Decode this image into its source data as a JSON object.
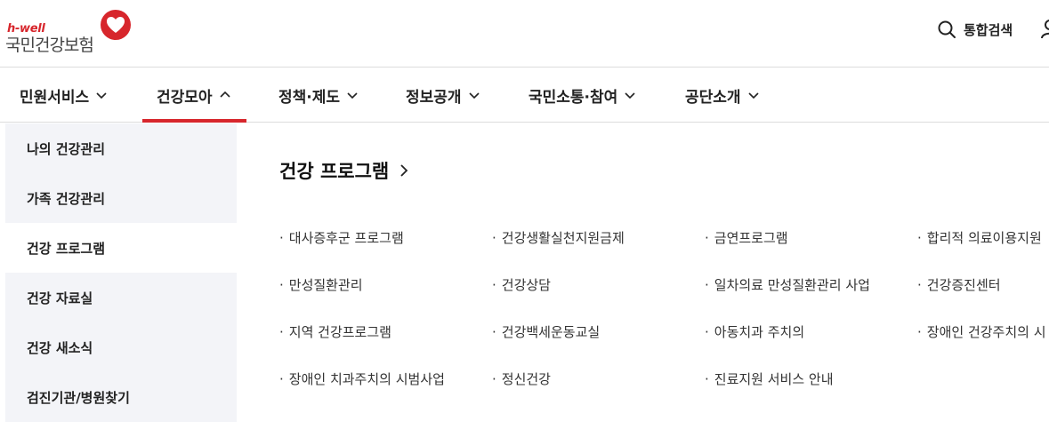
{
  "brand": {
    "logo_en": "h-well",
    "logo_ko": "국민건강보험",
    "accent_color": "#d7262c"
  },
  "header": {
    "search_label": "통합검색",
    "search_icon": "search-icon",
    "user_icon": "user-icon"
  },
  "gnb": {
    "items": [
      {
        "label": "민원서비스",
        "state": "collapsed"
      },
      {
        "label": "건강모아",
        "state": "expanded"
      },
      {
        "label": "정책·제도",
        "state": "collapsed"
      },
      {
        "label": "정보공개",
        "state": "collapsed"
      },
      {
        "label": "국민소통·참여",
        "state": "collapsed"
      },
      {
        "label": "공단소개",
        "state": "collapsed"
      }
    ]
  },
  "lnb": {
    "items": [
      {
        "label": "나의 건강관리"
      },
      {
        "label": "가족 건강관리"
      },
      {
        "label": "건강 프로그램"
      },
      {
        "label": "건강 자료실"
      },
      {
        "label": "건강 새소식"
      },
      {
        "label": "검진기관/병원찾기"
      }
    ],
    "active_index": 2
  },
  "content": {
    "title": "건강 프로그램",
    "columns": [
      [
        "대사증후군 프로그램",
        "만성질환관리",
        "지역 건강프로그램",
        "장애인 치과주치의 시범사업"
      ],
      [
        "건강생활실천지원금제",
        "건강상담",
        "건강백세운동교실",
        "정신건강"
      ],
      [
        "금연프로그램",
        "일차의료 만성질환관리 사업",
        "아동치과 주치의",
        "진료지원 서비스 안내"
      ],
      [
        "합리적 의료이용지원",
        "건강증진센터",
        "장애인 건강주치의 시"
      ]
    ]
  }
}
